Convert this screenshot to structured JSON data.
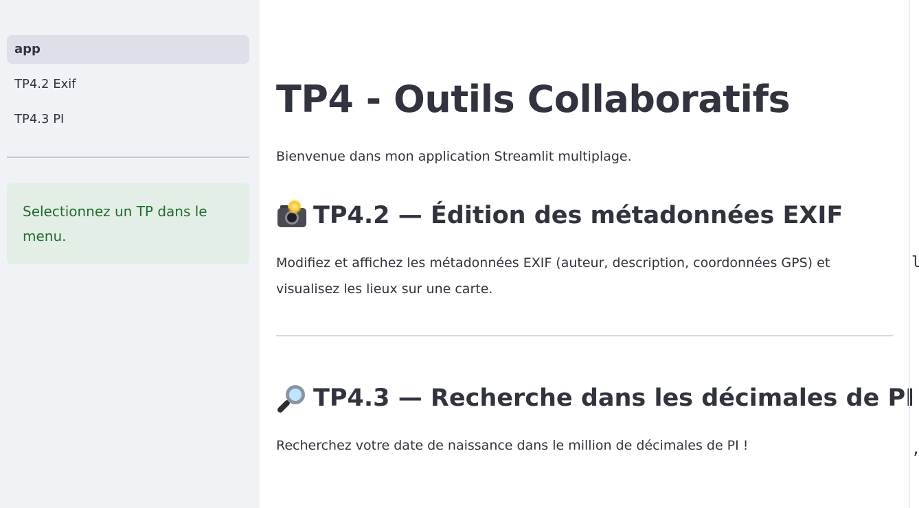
{
  "sidebar": {
    "nav_items": [
      {
        "label": "app",
        "active": true
      },
      {
        "label": "TP4.2 Exif",
        "active": false
      },
      {
        "label": "TP4.3 PI",
        "active": false
      }
    ],
    "info_message": "Selectionnez un TP dans le menu."
  },
  "main": {
    "title": "TP4 - Outils Collaboratifs",
    "intro": "Bienvenue dans mon application Streamlit multiplage.",
    "sections": [
      {
        "icon": "camera-flash-icon",
        "heading": "TP4.2 — Édition des métadonnées EXIF",
        "text": "Modifiez et affichez les métadonnées EXIF (auteur, description, coordonnées GPS) et visualisez les lieux sur une carte."
      },
      {
        "icon": "magnifying-glass-icon",
        "heading": "TP4.3 — Recherche dans les décimales de PI",
        "text": "Recherchez votre date de naissance dans le million de décimales de PI !"
      }
    ]
  },
  "edge": {
    "fragment_top": "l",
    "fragment_bottom": ","
  },
  "colors": {
    "sidebar_bg": "#f0f2f6",
    "active_nav_bg": "#dde0e8",
    "info_bg": "#e3eee6",
    "info_text": "#1f6e2a",
    "text": "#31333f"
  }
}
